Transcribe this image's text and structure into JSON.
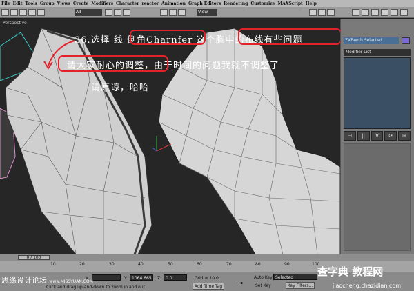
{
  "menu": {
    "items": [
      "File",
      "Edit",
      "Tools",
      "Group",
      "Views",
      "Create",
      "Modifiers",
      "Character",
      "reactor",
      "Animation",
      "Graph Editors",
      "Rendering",
      "Customize",
      "MAXScript",
      "Help"
    ]
  },
  "toolbar": {
    "selection_filter": "All",
    "view_dropdown": "View"
  },
  "viewport": {
    "label": "Perspective"
  },
  "annotation": {
    "line1": "36.选择 线 倒角Charnfer 这个胸中的布线有些问题",
    "line2": "请大家耐心的调整，由于时间的问题我就不调整了",
    "line3": "请原谅，哈哈",
    "highlight_color": "#e4222a"
  },
  "command_panel": {
    "object_name": "ZXBeoth Selected",
    "object_color": "#7b69d6",
    "modifier_list": "Modifier List",
    "stack_icons": [
      "⊣",
      "||",
      "∀",
      "⟳",
      "⊞"
    ]
  },
  "timeline": {
    "frame_display": "0 / 100",
    "ticks": [
      "10",
      "20",
      "30",
      "40",
      "50",
      "60",
      "70",
      "80",
      "90",
      "100"
    ]
  },
  "status": {
    "prompt": "Click and drag up-and-down to zoom in and out",
    "x_label": "X",
    "y_label": "Y:",
    "y_value": "1064.665",
    "z_label": "Z:",
    "z_value": "0.0",
    "grid": "Grid = 10.0",
    "add_time_tag": "Add Time Tag",
    "auto_key": "Auto Key",
    "auto_key_mode": "Selected",
    "set_key": "Set Key",
    "key_filters": "Key Filters..."
  },
  "watermark": {
    "left": "思缘设计论坛",
    "left_url": "www.MISSYUAN.COM",
    "right": "查字典 教程网",
    "right_url": "jiaocheng.chazidian.com"
  }
}
